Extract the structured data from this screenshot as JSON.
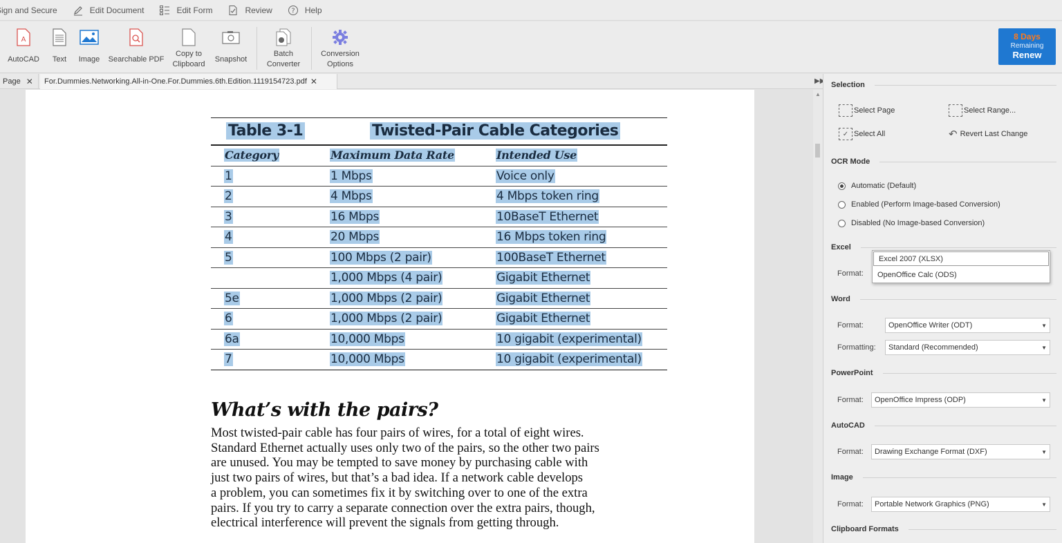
{
  "menubar": {
    "items": [
      {
        "label": "Sign and Secure",
        "icon": "sign-icon"
      },
      {
        "label": "Edit Document",
        "icon": "pen-icon"
      },
      {
        "label": "Edit Form",
        "icon": "form-icon"
      },
      {
        "label": "Review",
        "icon": "review-icon"
      },
      {
        "label": "Help",
        "icon": "help-icon"
      }
    ]
  },
  "ribbon": {
    "autocad": "AutoCAD",
    "text": "Text",
    "image": "Image",
    "searchable_pdf": "Searchable PDF",
    "copy_line1": "Copy to",
    "copy_line2": "Clipboard",
    "snapshot": "Snapshot",
    "batch_line1": "Batch",
    "batch_line2": "Converter",
    "conv_line1": "Conversion",
    "conv_line2": "Options",
    "renew_days": "8 Days",
    "renew_remaining": "Remaining",
    "renew_label": "Renew"
  },
  "tabs": {
    "tab1": "Page",
    "tab2": "For.Dummies.Networking.All-in-One.For.Dummies.6th.Edition.1119154723.pdf",
    "close": "✕"
  },
  "document": {
    "table_number": "Table 3-1",
    "table_title": "Twisted-Pair Cable Categories",
    "headers": [
      "Category",
      "Maximum Data Rate",
      "Intended Use"
    ],
    "rows": [
      [
        "1",
        "1 Mbps",
        "Voice only"
      ],
      [
        "2",
        "4 Mbps",
        "4 Mbps token ring"
      ],
      [
        "3",
        "16 Mbps",
        "10BaseT Ethernet"
      ],
      [
        "4",
        "20 Mbps",
        "16 Mbps token ring"
      ],
      [
        "5",
        "100 Mbps (2 pair)",
        "100BaseT Ethernet"
      ],
      [
        "",
        "1,000 Mbps (4 pair)",
        "Gigabit Ethernet"
      ],
      [
        "5e",
        "1,000 Mbps (2 pair)",
        "Gigabit Ethernet"
      ],
      [
        "6",
        "1,000 Mbps (2 pair)",
        "Gigabit Ethernet"
      ],
      [
        "6a",
        "10,000 Mbps",
        "10 gigabit (experimental)"
      ],
      [
        "7",
        "10,000 Mbps",
        "10 gigabit (experimental)"
      ]
    ],
    "heading": "What’s with the pairs?",
    "body_lines": [
      "Most twisted-pair cable has four pairs of wires, for a total of eight wires.",
      "Standard Ethernet actually uses only two of the pairs, so the other two pairs",
      "are unused. You may be tempted to save money by purchasing cable with",
      "just two pairs of wires, but that’s a bad idea. If a network cable develops",
      "a problem, you can sometimes fix it by switching over to one of the extra",
      "pairs. If you try to carry a separate connection over the extra pairs, though,",
      "electrical interference will prevent the signals from getting through."
    ]
  },
  "panel": {
    "selection": {
      "title": "Selection",
      "select_page": "Select Page",
      "select_range": "Select Range...",
      "select_all": "Select All",
      "revert": "Revert Last Change"
    },
    "ocr": {
      "title": "OCR Mode",
      "options": [
        "Automatic (Default)",
        "Enabled (Perform Image-based Conversion)",
        "Disabled (No Image-based Conversion)"
      ],
      "selected_index": 0
    },
    "excel": {
      "title": "Excel",
      "format_label": "Format:",
      "dropdown_options": [
        "Excel 2007 (XLSX)",
        "OpenOffice Calc (ODS)"
      ]
    },
    "word": {
      "title": "Word",
      "format_label": "Format:",
      "format_value": "OpenOffice Writer (ODT)",
      "formatting_label": "Formatting:",
      "formatting_value": "Standard (Recommended)"
    },
    "powerpoint": {
      "title": "PowerPoint",
      "format_label": "Format:",
      "format_value": "OpenOffice Impress (ODP)"
    },
    "autocad": {
      "title": "AutoCAD",
      "format_label": "Format:",
      "format_value": "Drawing Exchange Format (DXF)"
    },
    "image": {
      "title": "Image",
      "format_label": "Format:",
      "format_value": "Portable Network Graphics (PNG)"
    },
    "clipboard": {
      "title": "Clipboard Formats"
    }
  },
  "colors": {
    "accent": "#1f78d1",
    "renew_days": "#ff7a1a",
    "selection_highlight": "#a9cbe8"
  }
}
